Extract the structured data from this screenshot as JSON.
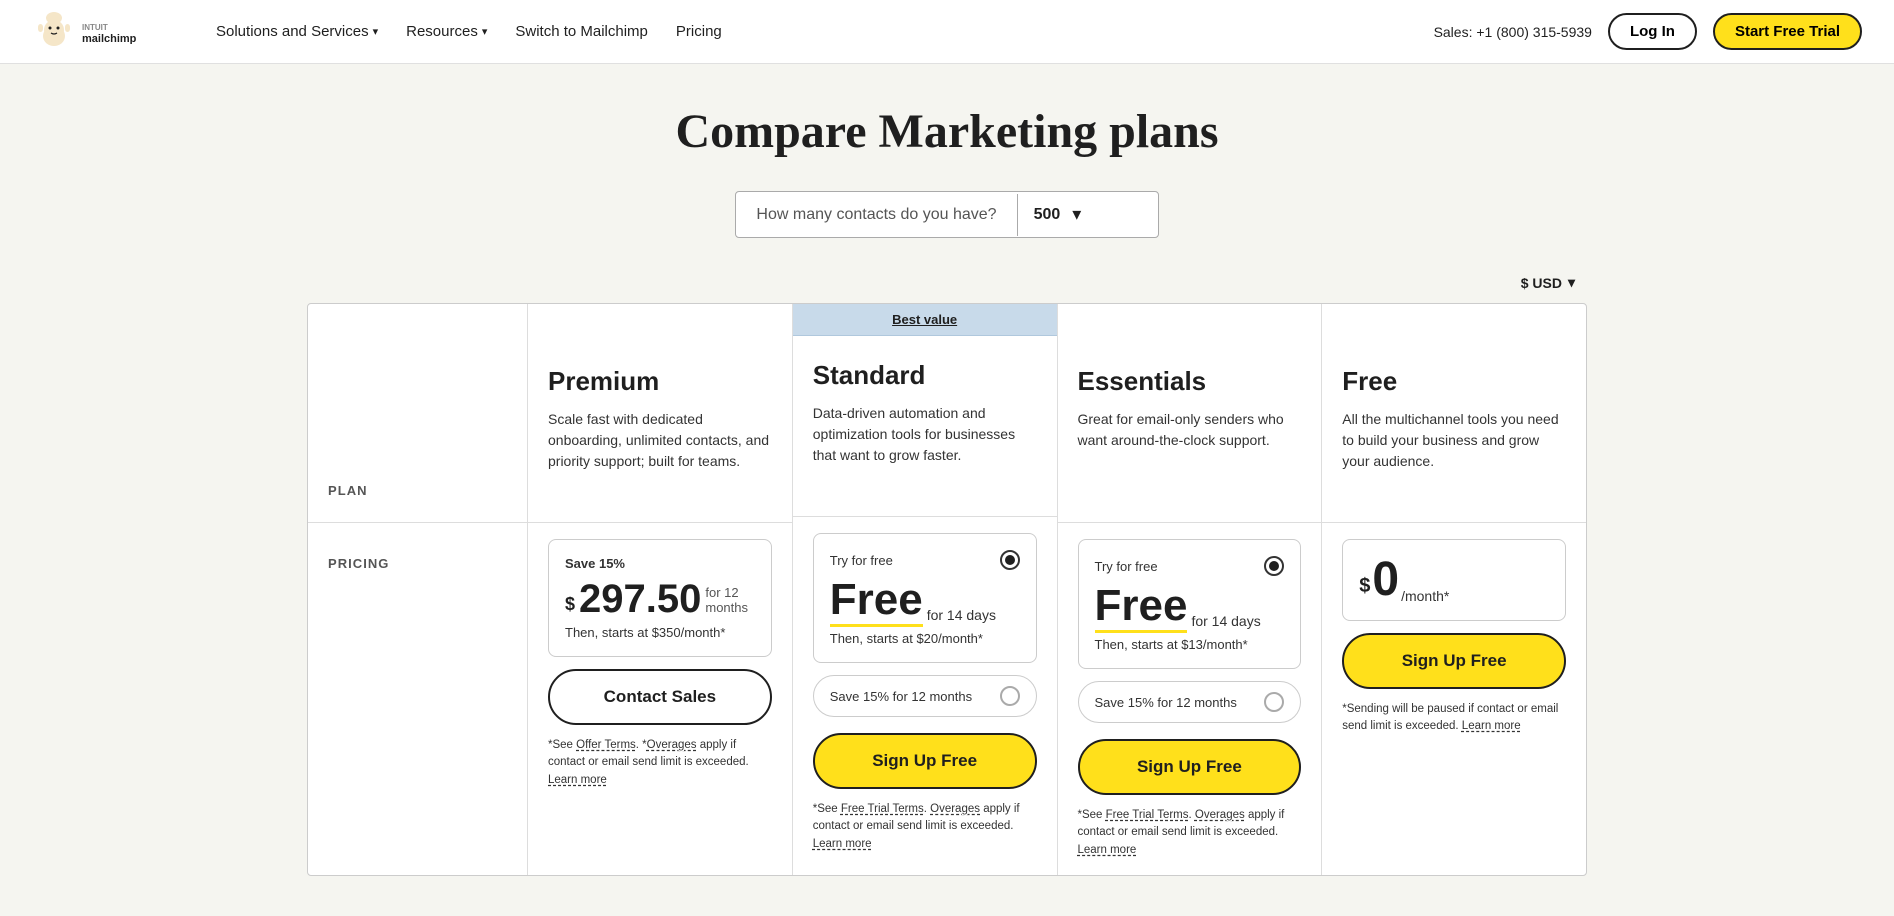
{
  "nav": {
    "logo_alt": "Intuit Mailchimp",
    "links": [
      {
        "label": "Solutions and Services",
        "has_dropdown": true
      },
      {
        "label": "Resources",
        "has_dropdown": true
      },
      {
        "label": "Switch to Mailchimp",
        "has_dropdown": false
      },
      {
        "label": "Pricing",
        "has_dropdown": false
      }
    ],
    "sales_text": "Sales: +1 (800) 315-5939",
    "login_label": "Log In",
    "trial_label": "Start Free Trial"
  },
  "page": {
    "title": "Compare Marketing plans",
    "contact_label": "How many contacts do you have?",
    "contact_value": "500",
    "currency_label": "$ USD",
    "label_plan": "PLAN",
    "label_pricing": "PRICING"
  },
  "plans": [
    {
      "id": "premium",
      "name": "Premium",
      "best_value": false,
      "desc": "Scale fast with dedicated onboarding, unlimited contacts, and priority support; built for teams.",
      "pricing": {
        "save_label": "Save 15%",
        "dollar": "$",
        "amount": "297.50",
        "period": "for 12 months",
        "then": "Then, starts at $350/month*"
      },
      "cta_label": "Contact Sales",
      "cta_type": "contact",
      "fine_print": "*See Offer Terms. *Overages apply if contact or email send limit is exceeded. Learn more"
    },
    {
      "id": "standard",
      "name": "Standard",
      "best_value": true,
      "best_value_label": "Best value",
      "desc": "Data-driven automation and optimization tools for businesses that want to grow faster.",
      "try_free": true,
      "try_free_label": "Try for free",
      "free_label": "Free",
      "free_period": "for 14 days",
      "then": "Then, starts at $20/month*",
      "save_label": "Save 15% for 12 months",
      "cta_label": "Sign Up Free",
      "cta_type": "signup",
      "fine_print": "*See Free Trial Terms. Overages apply if contact or email send limit is exceeded. Learn more"
    },
    {
      "id": "essentials",
      "name": "Essentials",
      "best_value": false,
      "desc": "Great for email-only senders who want around-the-clock support.",
      "try_free": true,
      "try_free_label": "Try for free",
      "free_label": "Free",
      "free_period": "for 14 days",
      "then": "Then, starts at $13/month*",
      "save_label": "Save 15% for 12 months",
      "cta_label": "Sign Up Free",
      "cta_type": "signup",
      "fine_print": "*See Free Trial Terms. Overages apply if contact or email send limit is exceeded. Learn more"
    },
    {
      "id": "free",
      "name": "Free",
      "best_value": false,
      "desc": "All the multichannel tools you need to build your business and grow your audience.",
      "zero_dollar": "$",
      "zero_amount": "0",
      "zero_period": "/month*",
      "cta_label": "Sign Up Free",
      "cta_type": "signup",
      "fine_print": "*Sending will be paused if contact or email send limit is exceeded. Learn more"
    }
  ]
}
